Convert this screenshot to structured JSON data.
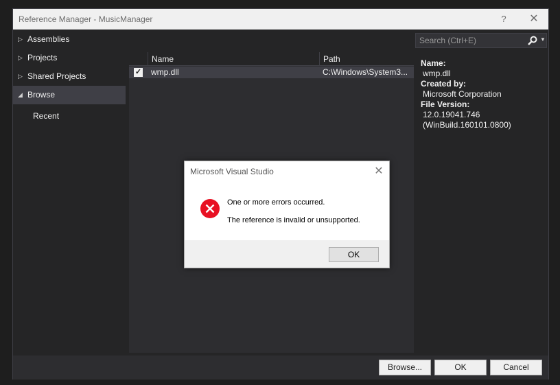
{
  "window": {
    "title": "Reference Manager - MusicManager",
    "help_label": "?",
    "close_label": "✕"
  },
  "sidebar": {
    "items": [
      {
        "label": "Assemblies",
        "expanded": false
      },
      {
        "label": "Projects",
        "expanded": false
      },
      {
        "label": "Shared Projects",
        "expanded": false
      },
      {
        "label": "Browse",
        "expanded": true,
        "selected": true
      }
    ],
    "sub_items": [
      {
        "label": "Recent"
      }
    ],
    "collapsed_glyph": "▷",
    "expanded_glyph": "◢"
  },
  "search": {
    "placeholder": "Search (Ctrl+E)",
    "value": ""
  },
  "table": {
    "columns": [
      "Name",
      "Path"
    ],
    "rows": [
      {
        "checked": true,
        "name": "wmp.dll",
        "path": "C:\\Windows\\System3..."
      }
    ]
  },
  "details": {
    "name_label": "Name:",
    "name_value": "wmp.dll",
    "created_label": "Created by:",
    "created_value": "Microsoft Corporation",
    "version_label": "File Version:",
    "version_value_1": "12.0.19041.746",
    "version_value_2": "(WinBuild.160101.0800)"
  },
  "footer": {
    "browse_label": "Browse...",
    "ok_label": "OK",
    "cancel_label": "Cancel"
  },
  "dialog": {
    "title": "Microsoft Visual Studio",
    "close_label": "✕",
    "message_1": "One or more errors occurred.",
    "message_2": "The reference is invalid or unsupported.",
    "ok_label": "OK",
    "error_color": "#e81123"
  }
}
